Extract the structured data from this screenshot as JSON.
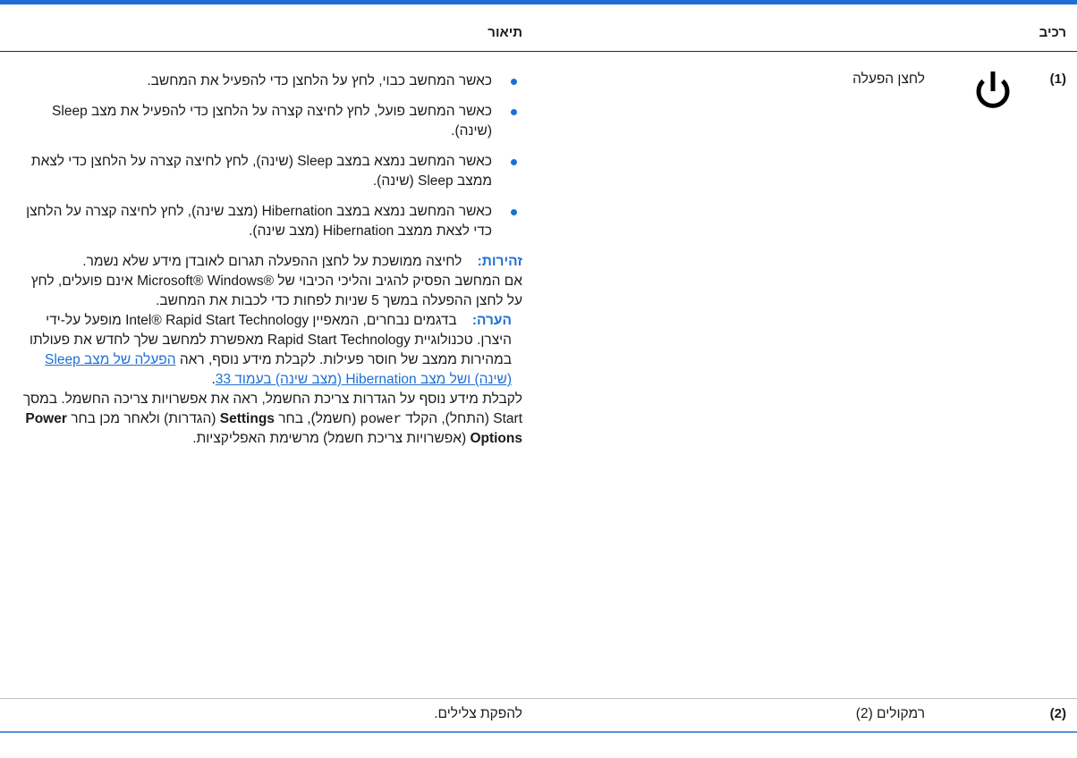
{
  "table": {
    "header": {
      "component": "רכיב",
      "description": "תיאור"
    },
    "rows": [
      {
        "number": "(1)",
        "icon": "power-icon",
        "name": "לחצן הפעלה",
        "bullets": [
          "כאשר המחשב כבוי, לחץ על הלחצן כדי להפעיל את המחשב.",
          "כאשר המחשב פועל, לחץ לחיצה קצרה על הלחצן כדי להפעיל את מצב Sleep (שינה).",
          "כאשר המחשב נמצא במצב Sleep (שינה), לחץ לחיצה קצרה על הלחצן כדי לצאת ממצב Sleep (שינה).",
          "כאשר המחשב נמצא במצב Hibernation (מצב שינה), לחץ לחיצה קצרה על הלחצן כדי לצאת ממצב Hibernation (מצב שינה)."
        ],
        "caution_label": "זהירות:",
        "caution_text": "לחיצה ממושכת על לחצן ההפעלה תגרום לאובדן מידע שלא נשמר.",
        "paragraph1": "אם המחשב הפסיק להגיב והליכי הכיבוי של ®Microsoft® Windows אינם פועלים, לחץ על לחצן ההפעלה במשך 5 שניות לפחות כדי לכבות את המחשב.",
        "note_label": "הערה:",
        "note_text": "בדגמים נבחרים, המאפיין Intel® Rapid Start Technology מופעל על-ידי היצרן. טכנולוגיית Rapid Start Technology מאפשרת למחשב שלך לחדש את פעולתו במהירות ממצב של חוסר פעילות. לקבלת מידע נוסף, ראה",
        "note_link": "הפעלה של מצב Sleep (שינה) ושל מצב Hibernation (מצב שינה) בעמוד 33",
        "note_end": ".",
        "power_p_a": "לקבלת מידע נוסף על הגדרות צריכת החשמל, ראה את אפשרויות צריכה החשמל. במסך Start (התחל), הקלד",
        "power_p_code": "power",
        "power_p_b": "(חשמל), בחר",
        "power_p_settings": "Settings",
        "power_p_c": "(הגדרות) ולאחר מכן בחר",
        "power_p_options": "Power Options",
        "power_p_d": "(אפשרויות צריכת חשמל) מרשימת האפליקציות."
      },
      {
        "number": "(2)",
        "name": "רמקולים (2)",
        "description": "להפקת צלילים."
      }
    ]
  }
}
